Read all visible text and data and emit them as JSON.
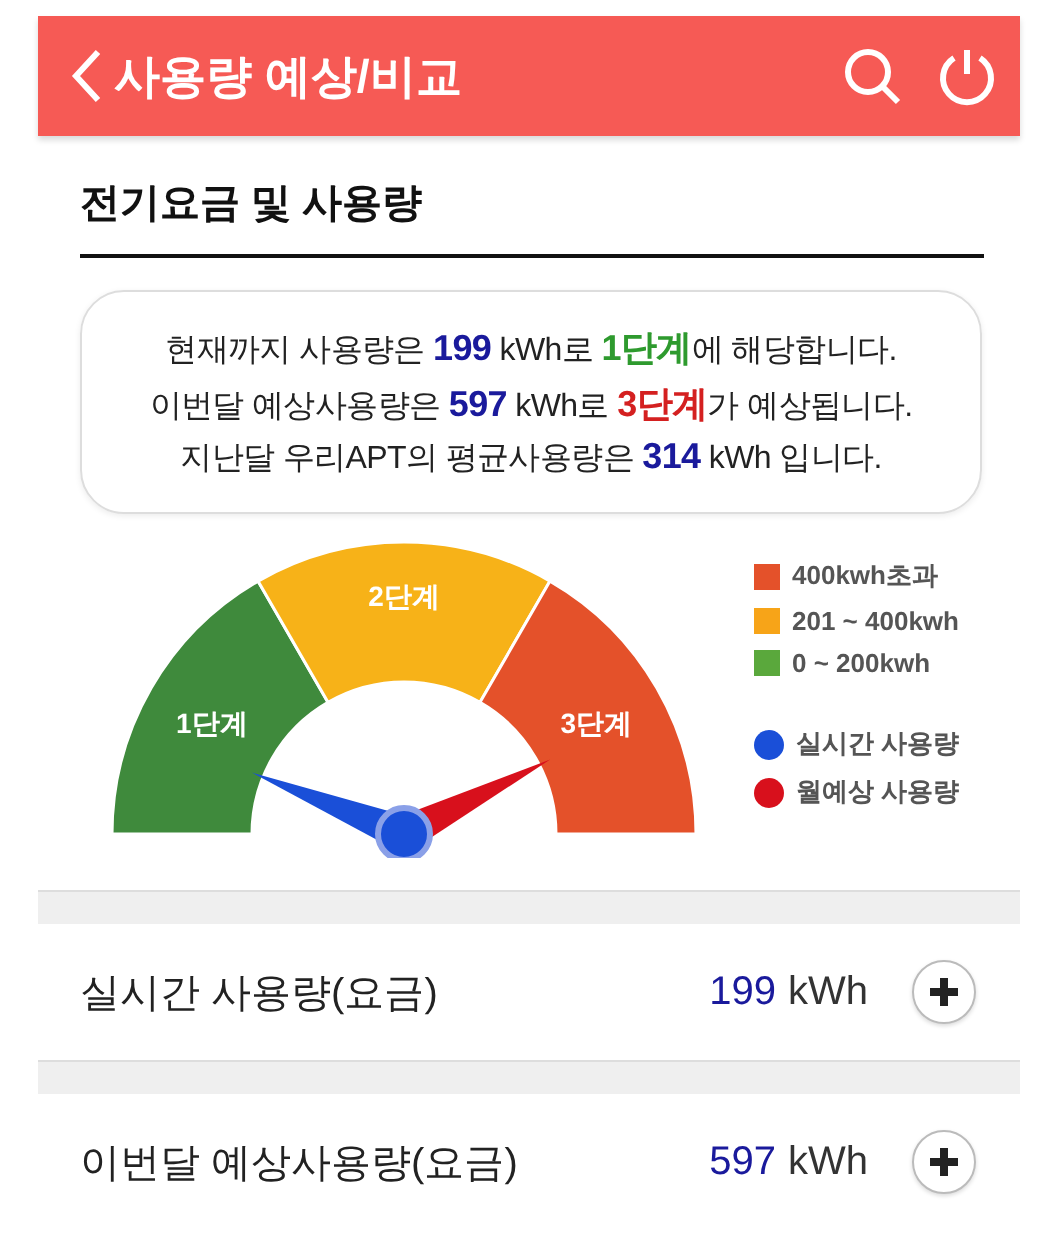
{
  "header": {
    "title": "사용량 예상/비교"
  },
  "section": {
    "title": "전기요금 및 사용량"
  },
  "summary": {
    "lines": [
      [
        {
          "text": "현재까지 사용량은 "
        },
        {
          "text": "199",
          "color": "#1a1a9c"
        },
        {
          "text": " kWh로 "
        },
        {
          "text": "1단계",
          "color": "#2e9a2e"
        },
        {
          "text": "에 해당합니다."
        }
      ],
      [
        {
          "text": "이번달 예상사용량은 "
        },
        {
          "text": "597",
          "color": "#1a1a9c"
        },
        {
          "text": " kWh로 "
        },
        {
          "text": "3단계",
          "color": "#d42020"
        },
        {
          "text": "가 예상됩니다."
        }
      ],
      [
        {
          "text": "지난달 우리APT의 평균사용량은 "
        },
        {
          "text": "314",
          "color": "#1a1a9c"
        },
        {
          "text": " kWh 입니다."
        }
      ]
    ]
  },
  "gauge": {
    "zones": [
      {
        "label": "1단계",
        "color": "#3f8a3c"
      },
      {
        "label": "2단계",
        "color": "#f7b218"
      },
      {
        "label": "3단계",
        "color": "#e4512a"
      }
    ],
    "legend": [
      {
        "kind": "square",
        "label": "400kwh초과",
        "color": "#e4512a"
      },
      {
        "kind": "square",
        "label": "201 ~ 400kwh",
        "color": "#f7a418"
      },
      {
        "kind": "square",
        "label": "0 ~ 200kwh",
        "color": "#5aa83c"
      },
      {
        "kind": "dot",
        "label": "실시간 사용량",
        "color": "#1a4fd8"
      },
      {
        "kind": "dot",
        "label": "월예상 사용량",
        "color": "#d8101c"
      }
    ]
  },
  "rows": [
    {
      "label": "실시간 사용량(요금)",
      "value": "199",
      "unit": "kWh"
    },
    {
      "label": "이번달 예상사용량(요금)",
      "value": "597",
      "unit": "kWh"
    }
  ]
}
